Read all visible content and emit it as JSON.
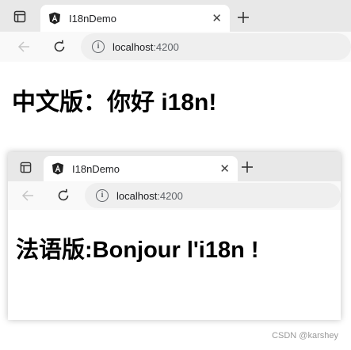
{
  "top_window": {
    "tab_title": "I18nDemo",
    "new_tab": "+",
    "close_tab": "✕",
    "address_host": "localhost",
    "address_port": ":4200",
    "page_heading": "中文版：你好 i18n!"
  },
  "bottom_window": {
    "tab_title": "I18nDemo",
    "new_tab": "+",
    "close_tab": "✕",
    "address_host": "localhost",
    "address_port": ":4200",
    "page_heading": "法语版:Bonjour l'i18n !"
  },
  "icons": [
    "sidebar-icon",
    "angular-logo-icon",
    "close-icon",
    "plus-icon",
    "back-arrow-icon",
    "reload-icon",
    "info-icon"
  ],
  "colors": {
    "tabbar": "#e8e8e8",
    "toolbar": "#f9f9f9",
    "address_bar": "#efefef",
    "disabled_icon": "#c4c4c4"
  },
  "watermark": "CSDN @karshey"
}
